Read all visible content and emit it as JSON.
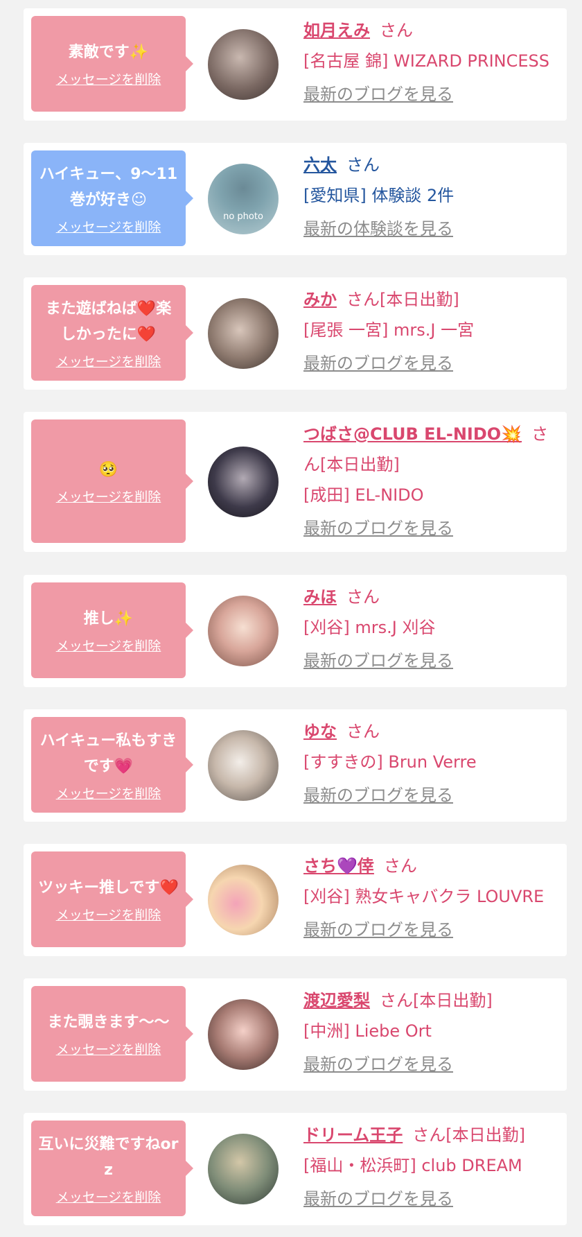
{
  "colors": {
    "pink_bubble": "#f09aa6",
    "blue_bubble": "#8ab4f8",
    "pink_text": "#d9476e",
    "blue_text": "#24569e",
    "link_gray": "#8c8c8c",
    "page_bg": "#f2f2f2"
  },
  "items": [
    {
      "bubble_color": "pink",
      "message": "素敵です✨",
      "delete_label": "メッセージを削除",
      "name": "如月えみ",
      "suffix": "さん",
      "shop": "[名古屋 錦] WIZARD PRINCESS",
      "blog_link": "最新のブログを見る",
      "avatar_icon": "user-photo"
    },
    {
      "bubble_color": "blue",
      "message": "ハイキュー、9〜11巻が好き☺",
      "delete_label": "メッセージを削除",
      "name": "六太",
      "suffix": "さん",
      "shop": "[愛知県] 体験談 2件",
      "blog_link": "最新の体験談を見る",
      "avatar_icon": "no-photo-placeholder",
      "avatar_label": "no photo"
    },
    {
      "bubble_color": "pink",
      "message": "また遊ばねば❤️楽しかったに❤️",
      "delete_label": "メッセージを削除",
      "name": "みか",
      "suffix": "さん[本日出勤]",
      "shop": "[尾張 一宮] mrs.J 一宮",
      "blog_link": "最新のブログを見る",
      "avatar_icon": "user-photo"
    },
    {
      "bubble_color": "pink",
      "message": "🥺",
      "delete_label": "メッセージを削除",
      "name": "つばさ@CLUB EL-NIDO💥",
      "suffix": "さん[本日出勤]",
      "shop": "[成田] EL-NIDO",
      "blog_link": "最新のブログを見る",
      "avatar_icon": "user-photo"
    },
    {
      "bubble_color": "pink",
      "message": "推し✨",
      "delete_label": "メッセージを削除",
      "name": "みほ",
      "suffix": "さん",
      "shop": "[刈谷] mrs.J 刈谷",
      "blog_link": "最新のブログを見る",
      "avatar_icon": "user-photo"
    },
    {
      "bubble_color": "pink",
      "message": "ハイキュー私もすきです💗",
      "delete_label": "メッセージを削除",
      "name": "ゆな",
      "suffix": "さん",
      "shop": "[すすきの] Brun Verre",
      "blog_link": "最新のブログを見る",
      "avatar_icon": "user-photo"
    },
    {
      "bubble_color": "pink",
      "message": "ツッキー推しです❤️",
      "delete_label": "メッセージを削除",
      "name": "さち💜倖",
      "suffix": "さん",
      "shop": "[刈谷] 熟女キャバクラ LOUVRE",
      "blog_link": "最新のブログを見る",
      "avatar_icon": "user-photo"
    },
    {
      "bubble_color": "pink",
      "message": "また覗きます〜〜",
      "delete_label": "メッセージを削除",
      "name": "渡辺愛梨",
      "suffix": "さん[本日出勤]",
      "shop": "[中洲] Liebe Ort",
      "blog_link": "最新のブログを見る",
      "avatar_icon": "user-photo"
    },
    {
      "bubble_color": "pink",
      "message": "互いに災難ですねorz",
      "delete_label": "メッセージを削除",
      "name": "ドリーム王子",
      "suffix": "さん[本日出勤]",
      "shop": "[福山・松浜町]  club DREAM",
      "blog_link": "最新のブログを見る",
      "avatar_icon": "user-photo"
    }
  ]
}
